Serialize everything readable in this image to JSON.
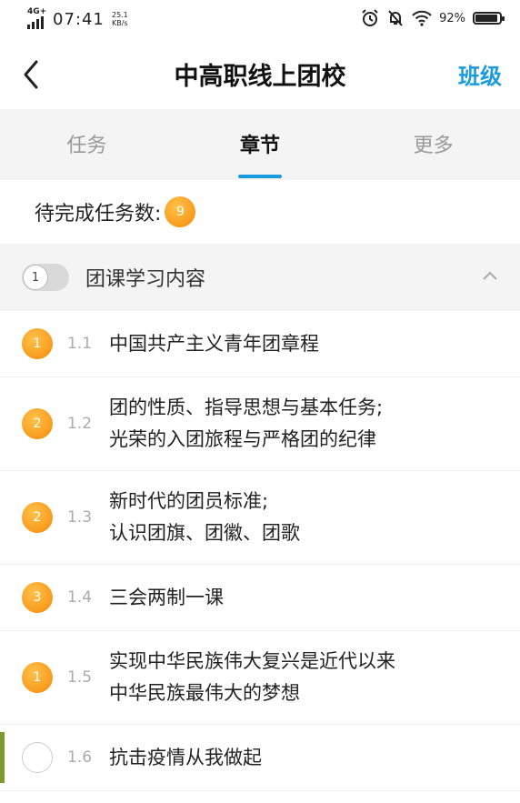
{
  "status_bar": {
    "network": "4G+",
    "time": "07:41",
    "speed_value": "25.1",
    "speed_unit": "KB/s",
    "battery_pct": "92%",
    "battery_level": 0.92
  },
  "navbar": {
    "title": "中高职线上团校",
    "right_button": "班级"
  },
  "tabs": [
    {
      "label": "任务",
      "active": false
    },
    {
      "label": "章节",
      "active": true
    },
    {
      "label": "更多",
      "active": false
    }
  ],
  "pending": {
    "label": "待完成任务数:",
    "count": "9"
  },
  "section": {
    "index": "1",
    "title": "团课学习内容"
  },
  "items": [
    {
      "badge": "1",
      "num": "1.1",
      "line1": "中国共产主义青年团章程",
      "line2": ""
    },
    {
      "badge": "2",
      "num": "1.2",
      "line1": "团的性质、指导思想与基本任务;",
      "line2": "光荣的入团旅程与严格团的纪律"
    },
    {
      "badge": "2",
      "num": "1.3",
      "line1": "新时代的团员标准;",
      "line2": "认识团旗、团徽、团歌"
    },
    {
      "badge": "3",
      "num": "1.4",
      "line1": "三会两制一课",
      "line2": ""
    },
    {
      "badge": "1",
      "num": "1.5",
      "line1": "实现中华民族伟大复兴是近代以来",
      "line2": "中华民族最伟大的梦想"
    },
    {
      "badge": "",
      "num": "1.6",
      "line1": "抗击疫情从我做起",
      "line2": ""
    }
  ],
  "colors": {
    "accent": "#1a9be0",
    "badge": "#f58a0a",
    "marker": "#7d9a2a"
  }
}
